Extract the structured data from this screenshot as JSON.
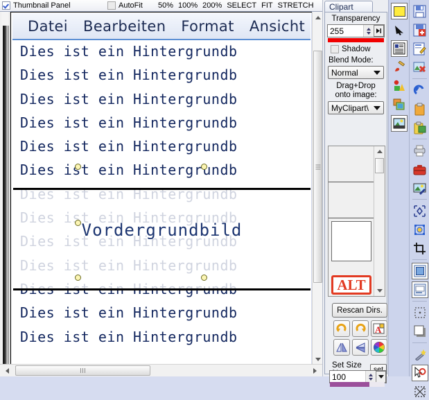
{
  "toolbar": {
    "thumbnail_panel_label": "Thumbnail Panel",
    "thumbnail_panel_checked": true,
    "autofit_label": "AutoFit",
    "autofit_checked": false,
    "zoom_50": "50%",
    "zoom_100": "100%",
    "zoom_200": "200%",
    "select": "SELECT",
    "fit": "FIT",
    "stretch": "STRETCH"
  },
  "document": {
    "menu": [
      "Datei",
      "Bearbeiten",
      "Format",
      "Ansicht"
    ],
    "background_line": "Dies ist ein Hintergrundb",
    "background_line_count": 13,
    "foreground_text": "Vordergrundbild"
  },
  "clipart": {
    "tab_label": "Clipart",
    "transparency_label": "Transparency",
    "transparency_value": "255",
    "transparency_color": "#f10000",
    "shadow_label": "Shadow",
    "shadow_checked": false,
    "blend_mode_label": "Blend Mode:",
    "blend_mode_value": "Normal",
    "dragdrop_line1": "Drag+Drop",
    "dragdrop_line2": "onto image:",
    "folder_value": "MyClipart\\",
    "alt_stamp_text": "ALT",
    "rescan_label": "Rescan Dirs.",
    "set_size_label": "Set Size %:",
    "set_label": "set",
    "size_value": "100",
    "size_bar_percent": 72,
    "transform_buttons": [
      "rotate-cw-icon",
      "rotate-ccw-icon",
      "text-color-icon",
      "flip-horizontal-icon",
      "flip-vertical-icon",
      "color-wheel-icon"
    ]
  },
  "rail_left": [
    "color-swatch-icon",
    "pointer-icon",
    "text-document-icon",
    "paintbrush-icon",
    "shapes-icon",
    "layers-icon",
    "image-icon"
  ],
  "rail_right": [
    "save-icon",
    "save-add-icon",
    "edit-icon",
    "delete-image-icon",
    "undo-icon",
    "clipboard-icon",
    "paste-icon",
    "printer-icon",
    "toolbox-icon",
    "image-effects-icon",
    "transform-icon",
    "resize-icon",
    "crop-icon",
    "frame-icon",
    "caption-icon",
    "marquee-icon",
    "shadow-box-icon",
    "magic-wand-icon",
    "cursor-red-icon",
    "deselect-icon"
  ]
}
